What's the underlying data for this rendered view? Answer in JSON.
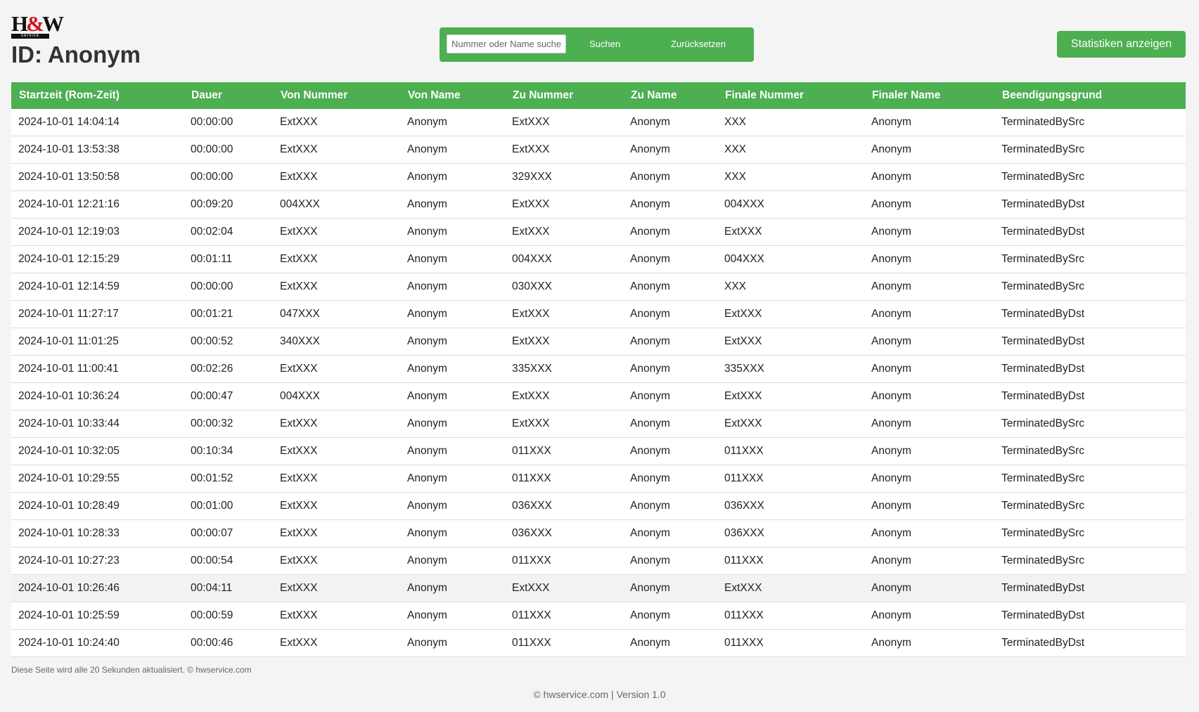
{
  "logo": {
    "main_left": "H",
    "main_amp": "&",
    "main_right": "W",
    "sub": "service"
  },
  "page_title": "ID: Anonym",
  "search": {
    "placeholder": "Nummer oder Name suchen",
    "value": "",
    "search_label": "Suchen",
    "reset_label": "Zurücksetzen"
  },
  "stats_button_label": "Statistiken anzeigen",
  "table": {
    "columns": [
      "Startzeit (Rom-Zeit)",
      "Dauer",
      "Von Nummer",
      "Von Name",
      "Zu Nummer",
      "Zu Name",
      "Finale Nummer",
      "Finaler Name",
      "Beendigungsgrund"
    ],
    "rows": [
      [
        "2024-10-01 14:04:14",
        "00:00:00",
        "ExtXXX",
        "Anonym",
        "ExtXXX",
        "Anonym",
        "XXX",
        "Anonym",
        "TerminatedBySrc"
      ],
      [
        "2024-10-01 13:53:38",
        "00:00:00",
        "ExtXXX",
        "Anonym",
        "ExtXXX",
        "Anonym",
        "XXX",
        "Anonym",
        "TerminatedBySrc"
      ],
      [
        "2024-10-01 13:50:58",
        "00:00:00",
        "ExtXXX",
        "Anonym",
        "329XXX",
        "Anonym",
        "XXX",
        "Anonym",
        "TerminatedBySrc"
      ],
      [
        "2024-10-01 12:21:16",
        "00:09:20",
        "004XXX",
        "Anonym",
        "ExtXXX",
        "Anonym",
        "004XXX",
        "Anonym",
        "TerminatedByDst"
      ],
      [
        "2024-10-01 12:19:03",
        "00:02:04",
        "ExtXXX",
        "Anonym",
        "ExtXXX",
        "Anonym",
        "ExtXXX",
        "Anonym",
        "TerminatedByDst"
      ],
      [
        "2024-10-01 12:15:29",
        "00:01:11",
        "ExtXXX",
        "Anonym",
        "004XXX",
        "Anonym",
        "004XXX",
        "Anonym",
        "TerminatedBySrc"
      ],
      [
        "2024-10-01 12:14:59",
        "00:00:00",
        "ExtXXX",
        "Anonym",
        "030XXX",
        "Anonym",
        "XXX",
        "Anonym",
        "TerminatedBySrc"
      ],
      [
        "2024-10-01 11:27:17",
        "00:01:21",
        "047XXX",
        "Anonym",
        "ExtXXX",
        "Anonym",
        "ExtXXX",
        "Anonym",
        "TerminatedByDst"
      ],
      [
        "2024-10-01 11:01:25",
        "00:00:52",
        "340XXX",
        "Anonym",
        "ExtXXX",
        "Anonym",
        "ExtXXX",
        "Anonym",
        "TerminatedByDst"
      ],
      [
        "2024-10-01 11:00:41",
        "00:02:26",
        "ExtXXX",
        "Anonym",
        "335XXX",
        "Anonym",
        "335XXX",
        "Anonym",
        "TerminatedByDst"
      ],
      [
        "2024-10-01 10:36:24",
        "00:00:47",
        "004XXX",
        "Anonym",
        "ExtXXX",
        "Anonym",
        "ExtXXX",
        "Anonym",
        "TerminatedByDst"
      ],
      [
        "2024-10-01 10:33:44",
        "00:00:32",
        "ExtXXX",
        "Anonym",
        "ExtXXX",
        "Anonym",
        "ExtXXX",
        "Anonym",
        "TerminatedBySrc"
      ],
      [
        "2024-10-01 10:32:05",
        "00:10:34",
        "ExtXXX",
        "Anonym",
        "011XXX",
        "Anonym",
        "011XXX",
        "Anonym",
        "TerminatedBySrc"
      ],
      [
        "2024-10-01 10:29:55",
        "00:01:52",
        "ExtXXX",
        "Anonym",
        "011XXX",
        "Anonym",
        "011XXX",
        "Anonym",
        "TerminatedBySrc"
      ],
      [
        "2024-10-01 10:28:49",
        "00:01:00",
        "ExtXXX",
        "Anonym",
        "036XXX",
        "Anonym",
        "036XXX",
        "Anonym",
        "TerminatedBySrc"
      ],
      [
        "2024-10-01 10:28:33",
        "00:00:07",
        "ExtXXX",
        "Anonym",
        "036XXX",
        "Anonym",
        "036XXX",
        "Anonym",
        "TerminatedBySrc"
      ],
      [
        "2024-10-01 10:27:23",
        "00:00:54",
        "ExtXXX",
        "Anonym",
        "011XXX",
        "Anonym",
        "011XXX",
        "Anonym",
        "TerminatedBySrc"
      ],
      [
        "2024-10-01 10:26:46",
        "00:04:11",
        "ExtXXX",
        "Anonym",
        "ExtXXX",
        "Anonym",
        "ExtXXX",
        "Anonym",
        "TerminatedByDst"
      ],
      [
        "2024-10-01 10:25:59",
        "00:00:59",
        "ExtXXX",
        "Anonym",
        "011XXX",
        "Anonym",
        "011XXX",
        "Anonym",
        "TerminatedByDst"
      ],
      [
        "2024-10-01 10:24:40",
        "00:00:46",
        "ExtXXX",
        "Anonym",
        "011XXX",
        "Anonym",
        "011XXX",
        "Anonym",
        "TerminatedByDst"
      ]
    ],
    "highlighted_row": 17
  },
  "footer_note": "Diese Seite wird alle 20 Sekunden aktualisiert. © hwservice.com",
  "footer": "© hwservice.com | Version 1.0",
  "colors": {
    "accent": "#4caf50",
    "background": "#f4f4f4",
    "logo_amp": "#d0161c"
  }
}
